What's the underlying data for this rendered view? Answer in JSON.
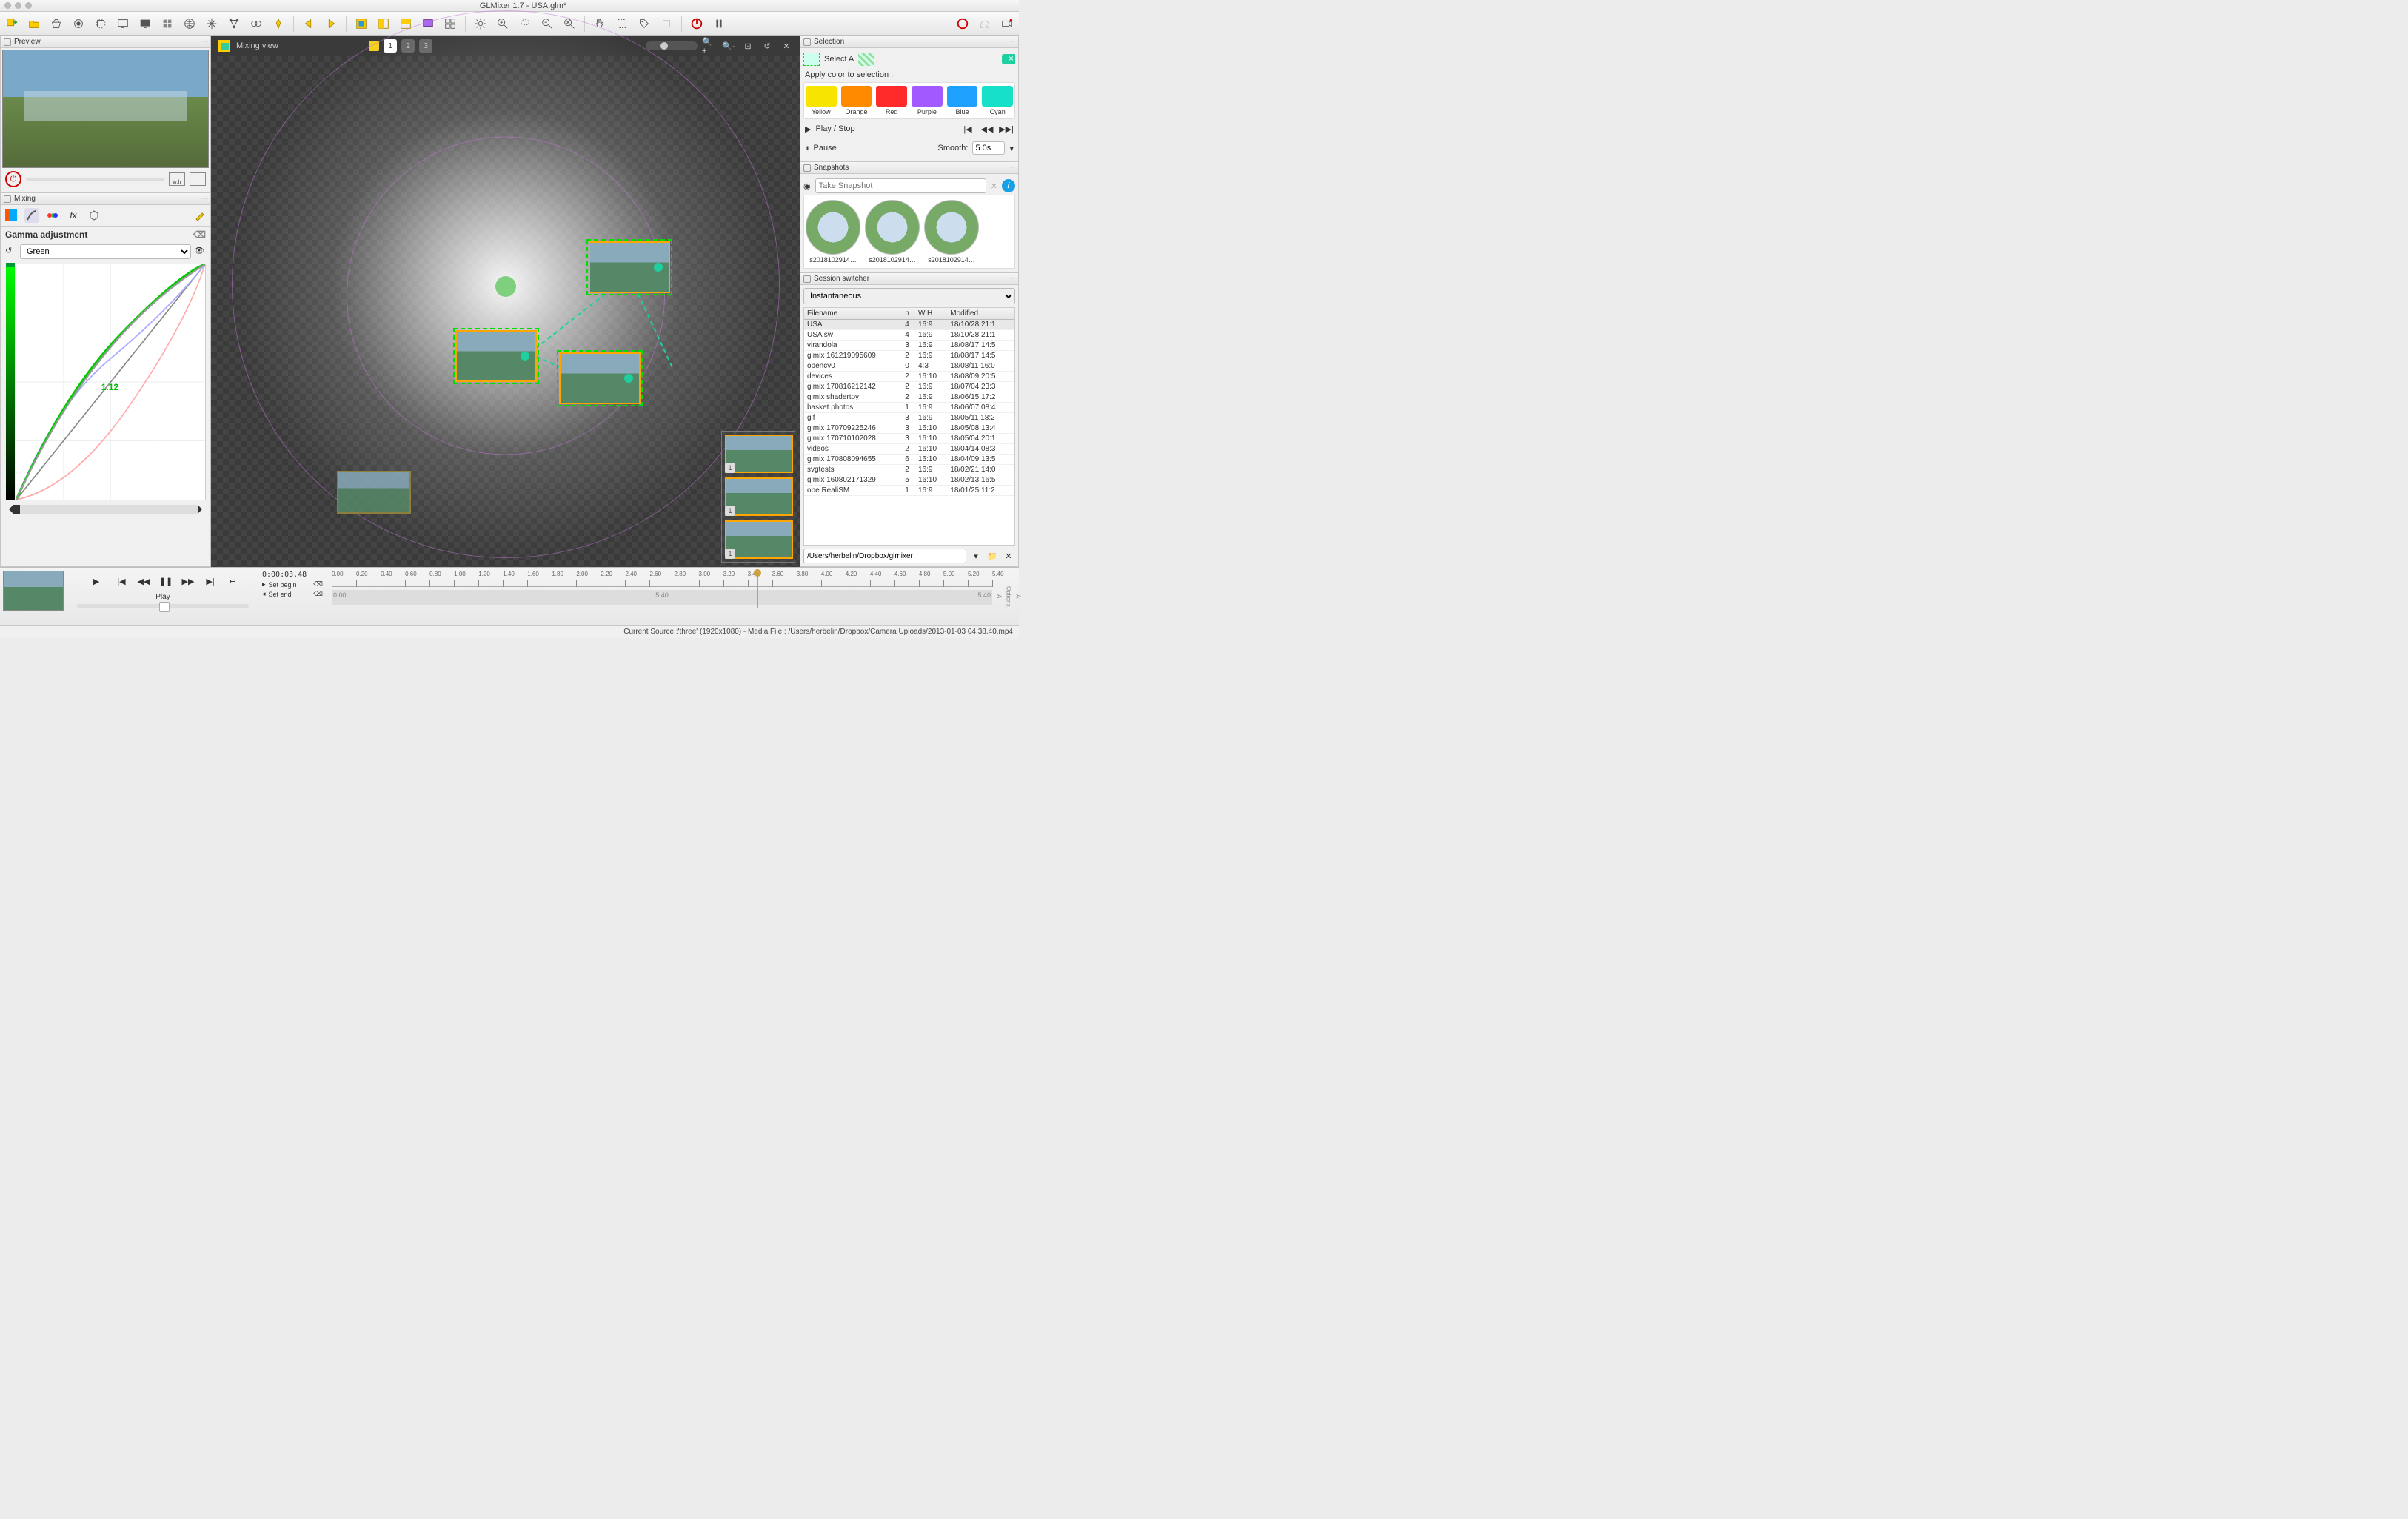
{
  "window": {
    "title": "GLMixer 1.7 - USA.glm*"
  },
  "panels": {
    "preview": "Preview",
    "mixing": "Mixing",
    "selection": "Selection",
    "snapshots": "Snapshots",
    "session": "Session switcher"
  },
  "mixing_view": {
    "label": "Mixing view",
    "pages": [
      "1",
      "2",
      "3"
    ],
    "active_page": "1"
  },
  "gamma": {
    "title": "Gamma adjustment",
    "channel": "Green",
    "value": "1.12"
  },
  "selection": {
    "select_all": "Select A",
    "apply_label": "Apply color to selection :",
    "colors": [
      {
        "name": "Yellow",
        "hex": "#f7e400"
      },
      {
        "name": "Orange",
        "hex": "#ff8a00"
      },
      {
        "name": "Red",
        "hex": "#ff2a2a"
      },
      {
        "name": "Purple",
        "hex": "#a259ff"
      },
      {
        "name": "Blue",
        "hex": "#1ea0ff"
      },
      {
        "name": "Cyan",
        "hex": "#17e0c8"
      }
    ],
    "play_stop": "Play / Stop",
    "pause": "Pause",
    "smooth_label": "Smooth:",
    "smooth_value": "5.0s"
  },
  "snapshots": {
    "take_placeholder": "Take Snapshot",
    "items": [
      "s2018102914…",
      "s2018102914…",
      "s2018102914…"
    ]
  },
  "session": {
    "mode": "Instantaneous",
    "columns": [
      "Filename",
      "n",
      "W:H",
      "Modified"
    ],
    "rows": [
      {
        "f": "USA",
        "n": "4",
        "wh": "16:9",
        "m": "18/10/28 21:1",
        "sel": true
      },
      {
        "f": "USA sw",
        "n": "4",
        "wh": "16:9",
        "m": "18/10/28 21:1"
      },
      {
        "f": "virandola",
        "n": "3",
        "wh": "16:9",
        "m": "18/08/17 14:5"
      },
      {
        "f": "glmix 161219095609",
        "n": "2",
        "wh": "16:9",
        "m": "18/08/17 14:5"
      },
      {
        "f": "opencv0",
        "n": "0",
        "wh": "4:3",
        "m": "18/08/11 16:0"
      },
      {
        "f": "devices",
        "n": "2",
        "wh": "16:10",
        "m": "18/08/09 20:5"
      },
      {
        "f": "glmix 170816212142",
        "n": "2",
        "wh": "16:9",
        "m": "18/07/04 23:3"
      },
      {
        "f": "glmix shadertoy",
        "n": "2",
        "wh": "16:9",
        "m": "18/06/15 17:2"
      },
      {
        "f": "basket photos",
        "n": "1",
        "wh": "16:9",
        "m": "18/06/07 08:4"
      },
      {
        "f": "gif",
        "n": "3",
        "wh": "16:9",
        "m": "18/05/11 18:2"
      },
      {
        "f": "glmix 170709225246",
        "n": "3",
        "wh": "16:10",
        "m": "18/05/08 13:4"
      },
      {
        "f": "glmix 170710102028",
        "n": "3",
        "wh": "16:10",
        "m": "18/05/04 20:1"
      },
      {
        "f": "videos",
        "n": "2",
        "wh": "16:10",
        "m": "18/04/14 08:3"
      },
      {
        "f": "glmix 170808094655",
        "n": "6",
        "wh": "16:10",
        "m": "18/04/09 13:5"
      },
      {
        "f": "svgtests",
        "n": "2",
        "wh": "16:9",
        "m": "18/02/21 14:0"
      },
      {
        "f": "glmix 160802171329",
        "n": "5",
        "wh": "16:10",
        "m": "18/02/13 16:5"
      },
      {
        "f": "obe RealiSM",
        "n": "1",
        "wh": "16:9",
        "m": "18/01/25 11:2"
      }
    ],
    "folder": "/Users/herbelin/Dropbox/glmixer"
  },
  "transport": {
    "timecode": "0:00:03.48",
    "play_label": "Play",
    "set_begin": "Set begin",
    "set_end": "Set end",
    "duration": "5.40",
    "start": "0.00",
    "end": "5.40",
    "ticks": [
      "0.00",
      "0.20",
      "0.40",
      "0.60",
      "0.80",
      "1.00",
      "1.20",
      "1.40",
      "1.60",
      "1.80",
      "2.00",
      "2.20",
      "2.40",
      "2.60",
      "2.80",
      "3.00",
      "3.20",
      "3.40",
      "3.60",
      "3.80",
      "4.00",
      "4.20",
      "4.40",
      "4.60",
      "4.80",
      "5.00",
      "5.20",
      "5.40"
    ],
    "playhead_pct": 64.4,
    "side_labels": [
      "A",
      "Options",
      "A"
    ]
  },
  "status": "Current Source :'three' (1920x1080) - Media File : /Users/herbelin/Dropbox/Camera Uploads/2013-01-03 04.38.40.mp4",
  "preview_aspect": "w:h"
}
